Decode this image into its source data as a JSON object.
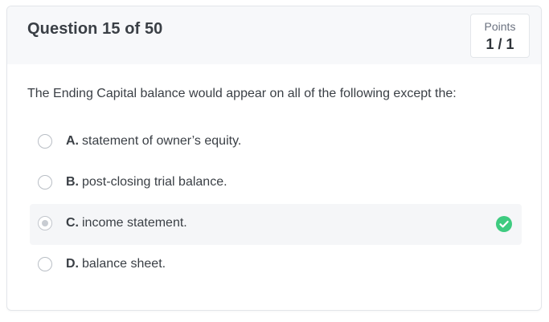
{
  "quiz": {
    "title": "Question 15 of 50",
    "points_label": "Points",
    "points_value": "1 / 1",
    "question": "The Ending Capital balance would appear on all of the following except the:",
    "options": [
      {
        "letter": "A.",
        "text": "statement of owner’s equity.",
        "selected": false,
        "correct": false
      },
      {
        "letter": "B.",
        "text": "post-closing trial balance.",
        "selected": false,
        "correct": false
      },
      {
        "letter": "C.",
        "text": "income statement.",
        "selected": true,
        "correct": true
      },
      {
        "letter": "D.",
        "text": "balance sheet.",
        "selected": false,
        "correct": false
      }
    ]
  },
  "colors": {
    "correct_check": "#3ecb80",
    "selected_row_bg": "#f5f6f8",
    "header_bg": "#f7f8fa"
  }
}
